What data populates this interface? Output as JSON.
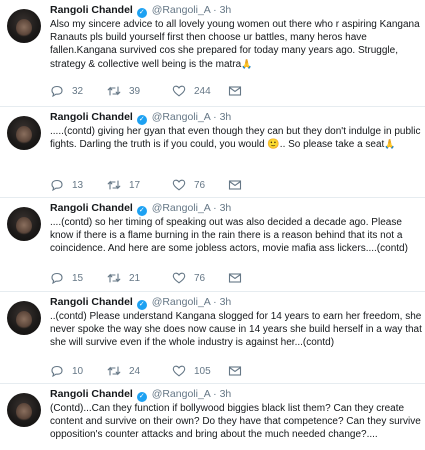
{
  "tweets": [
    {
      "name": "Rangoli Chandel",
      "handle": "@Rangoli_A",
      "dot": "·",
      "time": "3h",
      "text": "Also my sincere advice to all lovely young women out there who r aspiring Kangana Ranauts pls build yourself first then choose ur battles, many heros have fallen.Kangana survived cos she  prepared for today many years ago. Struggle, strategy & collective well being is the matra",
      "emoji": "🙏",
      "replies": "32",
      "retweets": "39",
      "likes": "244"
    },
    {
      "name": "Rangoli Chandel",
      "handle": "@Rangoli_A",
      "dot": "·",
      "time": "3h",
      "text": ".....(contd) giving her gyan that even though they can but they don't indulge in public fights. Darling the truth is if you could, you would",
      "text_after": ".. So please take a seat",
      "emoji": "🙂",
      "emoji2": "🙏",
      "replies": "13",
      "retweets": "17",
      "likes": "76"
    },
    {
      "name": "Rangoli Chandel",
      "handle": "@Rangoli_A",
      "dot": "·",
      "time": "3h",
      "text": "....(contd) so her timing of speaking out was also decided a decade ago. Please know if there is a flame burning in the rain there is a reason behind that its not a coincidence. And here are some jobless actors, movie mafia ass lickers....(contd)",
      "replies": "15",
      "retweets": "21",
      "likes": "76"
    },
    {
      "name": "Rangoli Chandel",
      "handle": "@Rangoli_A",
      "dot": "·",
      "time": "3h",
      "text": "..(contd) Please understand Kangana slogged for 14 years to earn her freedom, she never spoke the way she does now cause in 14 years she build herself in a way that she will survive even if the whole industry is against her...(contd)",
      "replies": "10",
      "retweets": "24",
      "likes": "105"
    },
    {
      "name": "Rangoli Chandel",
      "handle": "@Rangoli_A",
      "dot": "·",
      "time": "3h",
      "text": "(Contd)...Can they function if bollywood biggies black list them? Can they create content and survive on their own? Do they have that competence? Can they survive opposition's counter attacks and bring about the much needed change?...."
    }
  ],
  "icons": {
    "reply": "reply-icon",
    "retweet": "retweet-icon",
    "like": "like-icon",
    "message": "message-icon",
    "verified": "verified-badge-icon"
  },
  "colors": {
    "verified": "#1da1f2",
    "meta": "#657786",
    "divider": "#e6ecf0"
  }
}
